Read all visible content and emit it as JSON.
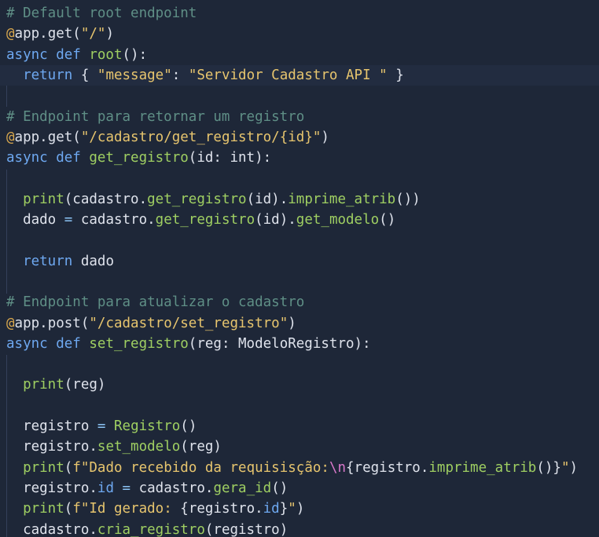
{
  "editor": {
    "lines": [
      {
        "tokens": [
          {
            "t": "# Default root endpoint",
            "k": "comment"
          }
        ]
      },
      {
        "tokens": [
          {
            "t": "@",
            "k": "decorator"
          },
          {
            "t": "app.get(",
            "k": "default"
          },
          {
            "t": "\"/\"",
            "k": "string"
          },
          {
            "t": ")",
            "k": "default"
          }
        ]
      },
      {
        "tokens": [
          {
            "t": "async def ",
            "k": "keyword"
          },
          {
            "t": "root",
            "k": "func"
          },
          {
            "t": "():",
            "k": "default"
          }
        ]
      },
      {
        "tokens": [
          {
            "t": "  ",
            "k": "default"
          },
          {
            "t": "return",
            "k": "keyword"
          },
          {
            "t": " { ",
            "k": "default"
          },
          {
            "t": "\"message\"",
            "k": "string"
          },
          {
            "t": ": ",
            "k": "default"
          },
          {
            "t": "\"Servidor Cadastro API \"",
            "k": "string"
          },
          {
            "t": " }",
            "k": "default"
          }
        ]
      },
      {
        "tokens": []
      },
      {
        "tokens": [
          {
            "t": "# Endpoint para retornar um registro",
            "k": "comment"
          }
        ]
      },
      {
        "tokens": [
          {
            "t": "@",
            "k": "decorator"
          },
          {
            "t": "app.get(",
            "k": "default"
          },
          {
            "t": "\"/cadastro/get_registro/{id}\"",
            "k": "string"
          },
          {
            "t": ")",
            "k": "default"
          }
        ]
      },
      {
        "tokens": [
          {
            "t": "async def ",
            "k": "keyword"
          },
          {
            "t": "get_registro",
            "k": "func"
          },
          {
            "t": "(id: int):",
            "k": "default"
          }
        ]
      },
      {
        "tokens": []
      },
      {
        "tokens": [
          {
            "t": "  ",
            "k": "default"
          },
          {
            "t": "print",
            "k": "func"
          },
          {
            "t": "(cadastro.",
            "k": "default"
          },
          {
            "t": "get_registro",
            "k": "func"
          },
          {
            "t": "(id).",
            "k": "default"
          },
          {
            "t": "imprime_atrib",
            "k": "func"
          },
          {
            "t": "())",
            "k": "default"
          }
        ]
      },
      {
        "tokens": [
          {
            "t": "  dado ",
            "k": "default"
          },
          {
            "t": "=",
            "k": "op"
          },
          {
            "t": " cadastro.",
            "k": "default"
          },
          {
            "t": "get_registro",
            "k": "func"
          },
          {
            "t": "(id).",
            "k": "default"
          },
          {
            "t": "get_modelo",
            "k": "func"
          },
          {
            "t": "()",
            "k": "default"
          }
        ]
      },
      {
        "tokens": []
      },
      {
        "tokens": [
          {
            "t": "  ",
            "k": "default"
          },
          {
            "t": "return",
            "k": "keyword"
          },
          {
            "t": " dado",
            "k": "default"
          }
        ]
      },
      {
        "tokens": []
      },
      {
        "tokens": [
          {
            "t": "# Endpoint para atualizar o cadastro",
            "k": "comment"
          }
        ]
      },
      {
        "tokens": [
          {
            "t": "@",
            "k": "decorator"
          },
          {
            "t": "app.post(",
            "k": "default"
          },
          {
            "t": "\"/cadastro/set_registro\"",
            "k": "string"
          },
          {
            "t": ")",
            "k": "default"
          }
        ]
      },
      {
        "tokens": [
          {
            "t": "async def ",
            "k": "keyword"
          },
          {
            "t": "set_registro",
            "k": "func"
          },
          {
            "t": "(reg: ModeloRegistro):",
            "k": "default"
          }
        ]
      },
      {
        "tokens": []
      },
      {
        "tokens": [
          {
            "t": "  ",
            "k": "default"
          },
          {
            "t": "print",
            "k": "func"
          },
          {
            "t": "(reg)",
            "k": "default"
          }
        ]
      },
      {
        "tokens": []
      },
      {
        "tokens": [
          {
            "t": "  registro ",
            "k": "default"
          },
          {
            "t": "=",
            "k": "op"
          },
          {
            "t": " ",
            "k": "default"
          },
          {
            "t": "Registro",
            "k": "func"
          },
          {
            "t": "()",
            "k": "default"
          }
        ]
      },
      {
        "tokens": [
          {
            "t": "  registro.",
            "k": "default"
          },
          {
            "t": "set_modelo",
            "k": "func"
          },
          {
            "t": "(reg)",
            "k": "default"
          }
        ]
      },
      {
        "tokens": [
          {
            "t": "  ",
            "k": "default"
          },
          {
            "t": "print",
            "k": "func"
          },
          {
            "t": "(",
            "k": "default"
          },
          {
            "t": "f\"Dado recebido da requisisção:",
            "k": "string"
          },
          {
            "t": "\\n",
            "k": "escape"
          },
          {
            "t": "{registro.",
            "k": "default"
          },
          {
            "t": "imprime_atrib",
            "k": "func"
          },
          {
            "t": "()}",
            "k": "default"
          },
          {
            "t": "\"",
            "k": "string"
          },
          {
            "t": ")",
            "k": "default"
          }
        ]
      },
      {
        "tokens": [
          {
            "t": "  registro.",
            "k": "default"
          },
          {
            "t": "id",
            "k": "keyword"
          },
          {
            "t": " ",
            "k": "default"
          },
          {
            "t": "=",
            "k": "op"
          },
          {
            "t": " cadastro.",
            "k": "default"
          },
          {
            "t": "gera_id",
            "k": "func"
          },
          {
            "t": "()",
            "k": "default"
          }
        ]
      },
      {
        "tokens": [
          {
            "t": "  ",
            "k": "default"
          },
          {
            "t": "print",
            "k": "func"
          },
          {
            "t": "(",
            "k": "default"
          },
          {
            "t": "f\"Id gerado: ",
            "k": "string"
          },
          {
            "t": "{registro.",
            "k": "default"
          },
          {
            "t": "id",
            "k": "keyword"
          },
          {
            "t": "}",
            "k": "default"
          },
          {
            "t": "\"",
            "k": "string"
          },
          {
            "t": ")",
            "k": "default"
          }
        ]
      },
      {
        "tokens": [
          {
            "t": "  cadastro.",
            "k": "default"
          },
          {
            "t": "cria_registro",
            "k": "func"
          },
          {
            "t": "(registro)",
            "k": "default"
          }
        ]
      }
    ]
  }
}
